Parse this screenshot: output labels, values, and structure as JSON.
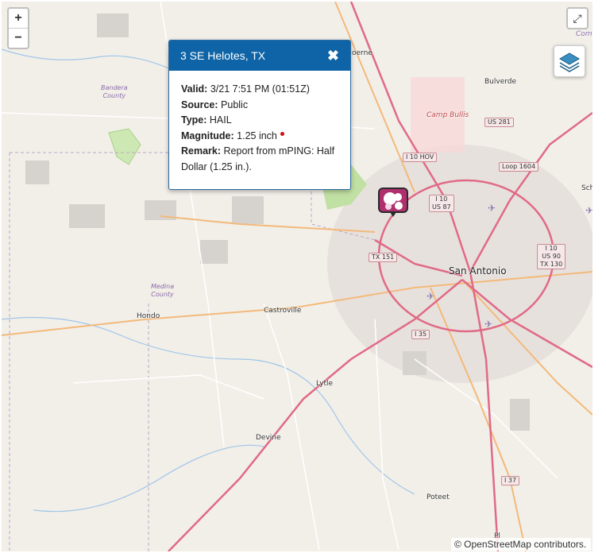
{
  "controls": {
    "zoom_in_label": "+",
    "zoom_out_label": "−",
    "fullscreen_glyph": "⤢",
    "layers_icon": "layers-icon"
  },
  "popup": {
    "title": "3 SE Helotes, TX",
    "close_glyph": "✖",
    "valid_label": "Valid:",
    "valid_value": "3/21 7:51 PM (01:51Z)",
    "source_label": "Source:",
    "source_value": "Public",
    "type_label": "Type:",
    "type_value": "HAIL",
    "magnitude_label": "Magnitude:",
    "magnitude_value": "1.25 inch",
    "remark_label": "Remark:",
    "remark_value": "Report from mPING: Half Dollar (1.25 in.).",
    "status_dot_color": "#d01010"
  },
  "marker": {
    "icon": "hail-report-icon",
    "color": "#b0306e"
  },
  "map": {
    "places": {
      "san_antonio": "San Antonio",
      "hondo": "Hondo",
      "castroville": "Castroville",
      "lytle": "Lytle",
      "devine": "Devine",
      "poteet": "Poteet",
      "bulverde": "Bulverde",
      "camp_bullis": "Camp Bullis",
      "boerne": "oerne",
      "comal": "Coma",
      "schertz": "Sch",
      "pleasanton": "Pl"
    },
    "counties": {
      "bandera": "Bandera\nCounty",
      "medina": "Medina\nCounty",
      "comal": "C"
    },
    "shields": {
      "us281": "US 281",
      "i10hov": "I 10 HOV",
      "loop1604": "Loop 1604",
      "i10us87": "I 10\nUS 87",
      "tx151": "TX 151",
      "i10us90": "I 10\nUS 90\nTX 130",
      "i35": "I 35",
      "i37": "I 37"
    }
  },
  "attribution": "© OpenStreetMap contributors."
}
